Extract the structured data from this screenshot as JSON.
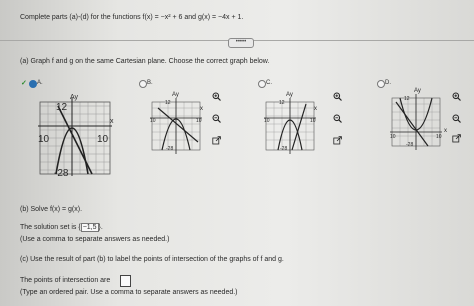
{
  "question": {
    "header": "Complete parts (a)-(d) for the functions f(x) = −x² + 6 and g(x) = −4x + 1.",
    "part_a": "(a) Graph f and g on the same Cartesian plane. Choose the correct graph below.",
    "part_b": "(b) Solve f(x) = g(x).",
    "solution_text": "The solution set is {",
    "solution_value": "−1,5",
    "solution_close": "}.",
    "hint_comma": "(Use a comma to separate answers as needed.)",
    "part_c": "(c) Use the result of part (b) to label the points of intersection of the graphs of f and g.",
    "intersection_text": "The points of intersection are",
    "hint_ordered_pair": "(Type an ordered pair. Use a comma to separate answers as needed.)"
  },
  "collapse_label": "•••••",
  "options": [
    {
      "letter": "A.",
      "selected": true,
      "ylabel": "Ay",
      "xlabel": "x",
      "ticks": [
        "12",
        "10",
        "10",
        "-28"
      ]
    },
    {
      "letter": "B.",
      "selected": false,
      "ylabel": "Ay",
      "xlabel": "x",
      "ticks": [
        "12",
        "10",
        "10",
        "-28"
      ]
    },
    {
      "letter": "C.",
      "selected": false,
      "ylabel": "Ay",
      "xlabel": "x",
      "ticks": [
        "12",
        "10",
        "10",
        "-28"
      ]
    },
    {
      "letter": "D.",
      "selected": false,
      "ylabel": "Ay",
      "xlabel": "x",
      "ticks": [
        "12",
        "10",
        "10",
        "-28"
      ]
    }
  ],
  "icons": {
    "check": "check-icon",
    "zoom_in": "zoom-in-icon",
    "zoom_out": "zoom-out-icon",
    "popout": "external-link-icon"
  },
  "colors": {
    "curve": "#222222",
    "check": "#2e8b2e",
    "grid": "#9a9a9a"
  }
}
